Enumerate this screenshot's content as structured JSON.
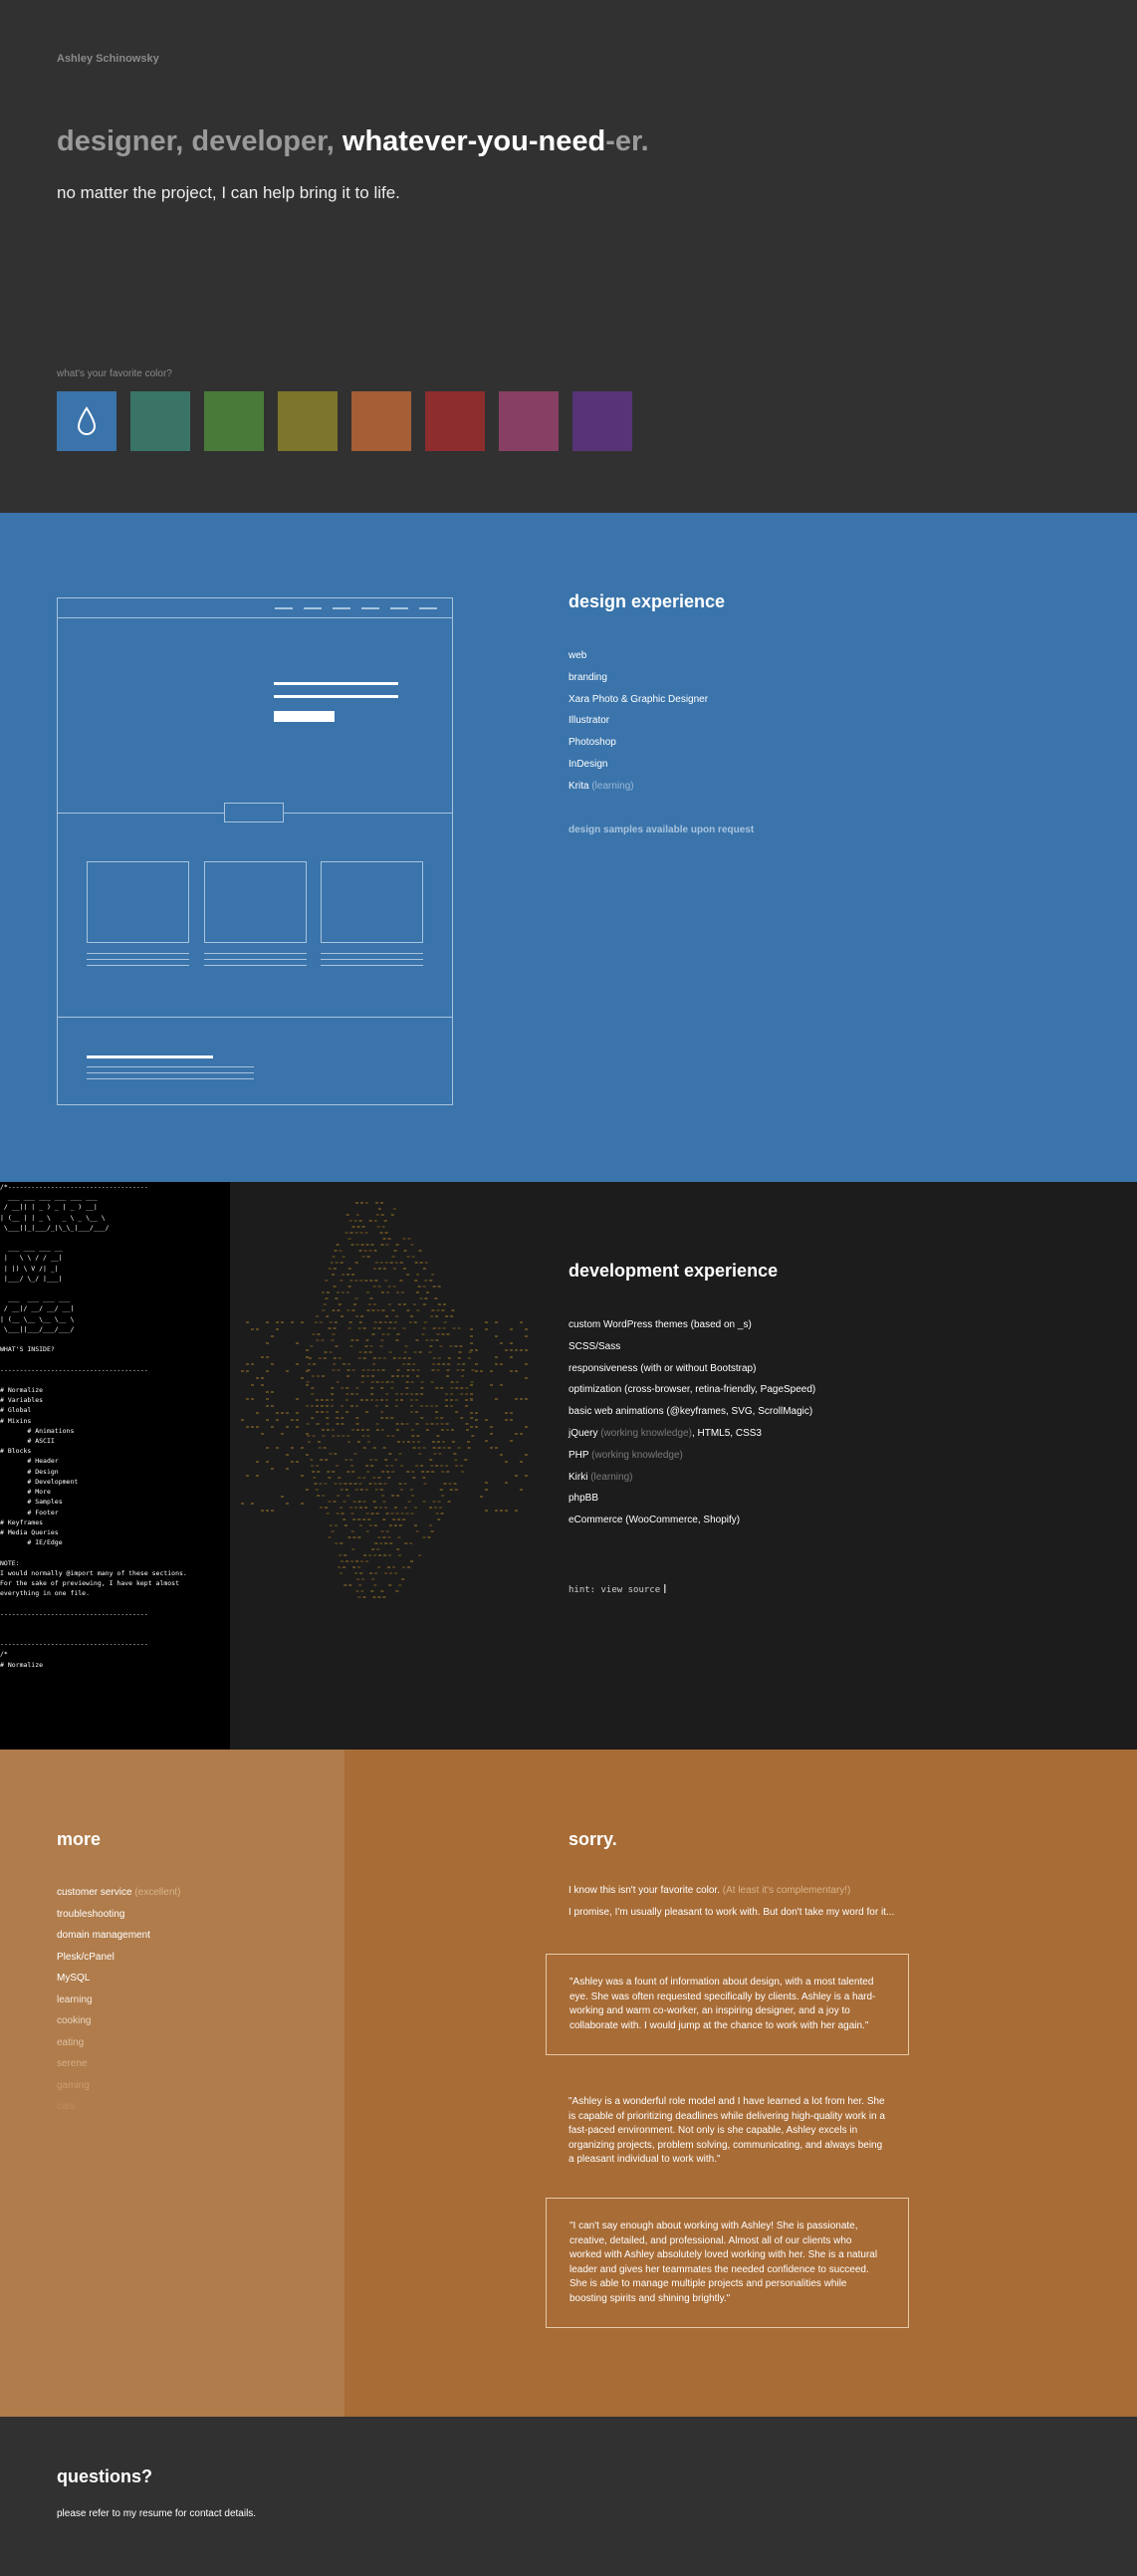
{
  "hero": {
    "brand": "Ashley Schinowsky",
    "headline_a": "designer, developer,",
    "headline_b": "whatever-you-need",
    "headline_c": "-er.",
    "subline": "no matter the project, I can help bring it to life.",
    "color_question": "what's your favorite color?",
    "swatches": [
      {
        "name": "blue",
        "color": "#3a74ab",
        "selected": true,
        "icon": "droplet-icon"
      },
      {
        "name": "teal",
        "color": "#3a7466"
      },
      {
        "name": "green",
        "color": "#4a7a3a"
      },
      {
        "name": "olive",
        "color": "#7d752c"
      },
      {
        "name": "rust",
        "color": "#a55e36"
      },
      {
        "name": "red",
        "color": "#8d2d2e"
      },
      {
        "name": "magenta",
        "color": "#873f64"
      },
      {
        "name": "purple",
        "color": "#573476"
      }
    ]
  },
  "design": {
    "title": "design experience",
    "items": [
      {
        "text": "web"
      },
      {
        "text": "branding"
      },
      {
        "text": "Xara Photo & Graphic Designer"
      },
      {
        "text": "Illustrator"
      },
      {
        "text": "Photoshop"
      },
      {
        "text": "InDesign"
      },
      {
        "text": "Krita",
        "note": "(learning)"
      }
    ],
    "samples_note": "design samples available upon request",
    "accent": "#3a74ab"
  },
  "dev": {
    "title": "development experience",
    "items": [
      {
        "text": "custom WordPress themes (based on _s)"
      },
      {
        "text": "SCSS/Sass"
      },
      {
        "text": "responsiveness (with or without Bootstrap)"
      },
      {
        "text": "optimization (cross-browser, retina-friendly, PageSpeed)"
      },
      {
        "text": "basic web animations (@keyframes, SVG, ScrollMagic)"
      },
      {
        "text": "jQuery",
        "note": "(working knowledge)",
        "after": ", HTML5, CSS3"
      },
      {
        "text": "PHP",
        "note": "(working knowledge)"
      },
      {
        "text": "Kirki",
        "note": "(learning)"
      },
      {
        "text": "phpBB"
      },
      {
        "text": "eCommerce (WooCommerce, Shopify)"
      }
    ],
    "hint": "hint: view source",
    "code": "/*------------------------------------\n  ___ ___ ___ ___ ___ ___\n / __|| | _ ) _ | _ ) __|\n| (__ | | _ \\   _ \\ _ \\__ \\\n \\___||_|___/_|\\_\\_|___/___/\n\n  ___ ___ ___ __\n |   \\ \\ / / __|\n | |) \\ V /| _|\n |___/ \\_/ |___|\n\n  ___  ___ ___ ___\n / __|/ __/ __/ __|\n| (__ \\__ \\__ \\__ \\\n \\___||___/___/___/\n\nWHAT'S INSIDE?\n\n--------------------------------------\n\n# Normalize\n# Variables\n# Global\n# Mixins\n       # Animations\n       # ASCII\n# Blocks\n       # Header\n       # Design\n       # Development\n       # More\n       # Samples\n       # Footer\n# Keyframes\n# Media Queries\n       # IE/Edge\n\nNOTE:\nI would normally @import many of these sections.\nFor the sake of previewing, I have kept almost\neverything in one file.\n\n--------------------------------------\n\n\n--------------------------------------\n/*\n# Normalize"
  },
  "more": {
    "title": "more",
    "items": [
      {
        "text": "customer service",
        "note": "(excellent)",
        "shade": "#ffffff"
      },
      {
        "text": "troubleshooting",
        "shade": "#ffffff"
      },
      {
        "text": "domain management",
        "shade": "#ffffff"
      },
      {
        "text": "Plesk/cPanel",
        "shade": "#ffffff"
      },
      {
        "text": "MySQL",
        "shade": "#ffffff"
      },
      {
        "text": "learning",
        "shade": "#f3e7dc"
      },
      {
        "text": "cooking",
        "shade": "#e8d4c0"
      },
      {
        "text": "eating",
        "shade": "#dec1a4"
      },
      {
        "text": "serene",
        "shade": "#d4af8a"
      },
      {
        "text": "gaming",
        "shade": "#ca9d72"
      },
      {
        "text": "cats",
        "shade": "#c08c5e"
      }
    ]
  },
  "sorry": {
    "title": "sorry.",
    "line1": "I know this isn't your favorite color.",
    "line1_note": "(At least it's complementary!)",
    "line2": "I promise, I'm usually pleasant to work with. But don't take my word for it...",
    "quotes": [
      "\"Ashley was a fount of information about design, with a most talented eye. She was often requested specifically by clients. Ashley is a hard-working and warm co-worker, an inspiring designer, and a joy to collaborate with. I would jump at the chance to work with her again.\"",
      "\"Ashley is a wonderful role model and I have learned a lot from her. She is capable of prioritizing deadlines while delivering high-quality work in a fast-paced environment. Not only is she capable, Ashley excels in organizing projects, problem solving, communicating, and always being a pleasant individual to work with.\"",
      "\"I can't say enough about working with Ashley! She is passionate, creative, detailed, and professional. Almost all of our clients who worked with Ashley absolutely loved working with her. She is a natural leader and gives her teammates the needed confidence to succeed. She is able to manage multiple projects and personalities while boosting spirits and shining brightly.\""
    ]
  },
  "footer": {
    "title": "questions?",
    "text": "please refer to my resume for contact details."
  }
}
